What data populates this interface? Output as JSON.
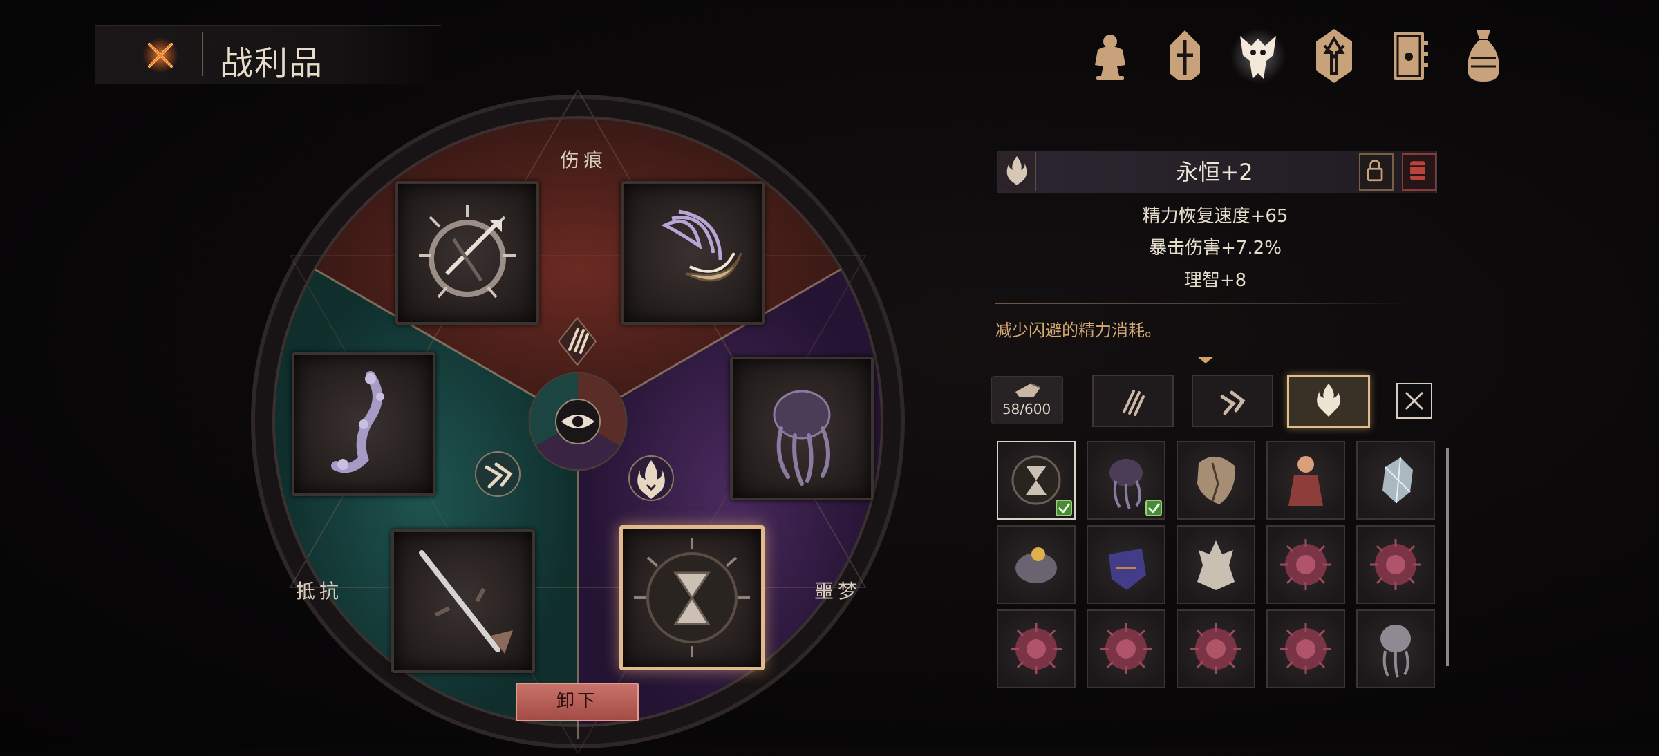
{
  "header": {
    "title": "战利品",
    "close_icon": "close-x-icon"
  },
  "tabs": [
    {
      "name": "character-icon",
      "active": false
    },
    {
      "name": "helmet-icon",
      "active": false
    },
    {
      "name": "beast-spoils-icon",
      "active": true
    },
    {
      "name": "shield-crest-icon",
      "active": false
    },
    {
      "name": "journal-icon",
      "active": false
    },
    {
      "name": "money-bag-icon",
      "active": false
    }
  ],
  "wheel": {
    "labels": {
      "top": "伤痕",
      "left": "抵抗",
      "right": "噩梦"
    },
    "unequip_label": "卸下",
    "colors": {
      "red": "#4a1f1b",
      "teal": "#123a38",
      "purple": "#2f1a3e"
    },
    "slots": [
      {
        "name": "spiked-wheel-trophy",
        "selected": false
      },
      {
        "name": "claw-shell-trophy",
        "selected": false
      },
      {
        "name": "bone-tendril-trophy",
        "selected": false
      },
      {
        "name": "tentacle-mass-trophy",
        "selected": false
      },
      {
        "name": "broken-sword-trophy",
        "selected": false
      },
      {
        "name": "hourglass-thorn-trophy",
        "selected": true
      }
    ]
  },
  "detail": {
    "item_name": "永恒+2",
    "stats": [
      "精力恢复速度+65",
      "暴击伤害+7.2%",
      "理智+8"
    ],
    "description": "减少闪避的精力消耗。"
  },
  "shards": {
    "count": "58/600"
  },
  "filters": [
    {
      "name": "claw-filter-icon",
      "active": false
    },
    {
      "name": "fang-filter-icon",
      "active": false
    },
    {
      "name": "flame-mask-filter-icon",
      "active": true
    }
  ],
  "inventory": [
    {
      "name": "hourglass-thorn-item",
      "equipped": true,
      "selected": true
    },
    {
      "name": "tentacle-mass-item",
      "equipped": true,
      "selected": false
    },
    {
      "name": "cracked-mask-item",
      "equipped": false,
      "selected": false
    },
    {
      "name": "doll-item",
      "equipped": false,
      "selected": false
    },
    {
      "name": "crystal-item",
      "equipped": false,
      "selected": false
    },
    {
      "name": "gem-cluster-item",
      "equipped": false,
      "selected": false
    },
    {
      "name": "violet-relic-item",
      "equipped": false,
      "selected": false
    },
    {
      "name": "dragon-skull-item",
      "equipped": false,
      "selected": false
    },
    {
      "name": "flesh-orb-item",
      "equipped": false,
      "selected": false
    },
    {
      "name": "flesh-orb-item",
      "equipped": false,
      "selected": false
    },
    {
      "name": "flesh-orb-item",
      "equipped": false,
      "selected": false
    },
    {
      "name": "flesh-orb-item",
      "equipped": false,
      "selected": false
    },
    {
      "name": "flesh-orb-item",
      "equipped": false,
      "selected": false
    },
    {
      "name": "flesh-orb-item",
      "equipped": false,
      "selected": false
    },
    {
      "name": "squid-head-item",
      "equipped": false,
      "selected": false
    }
  ]
}
